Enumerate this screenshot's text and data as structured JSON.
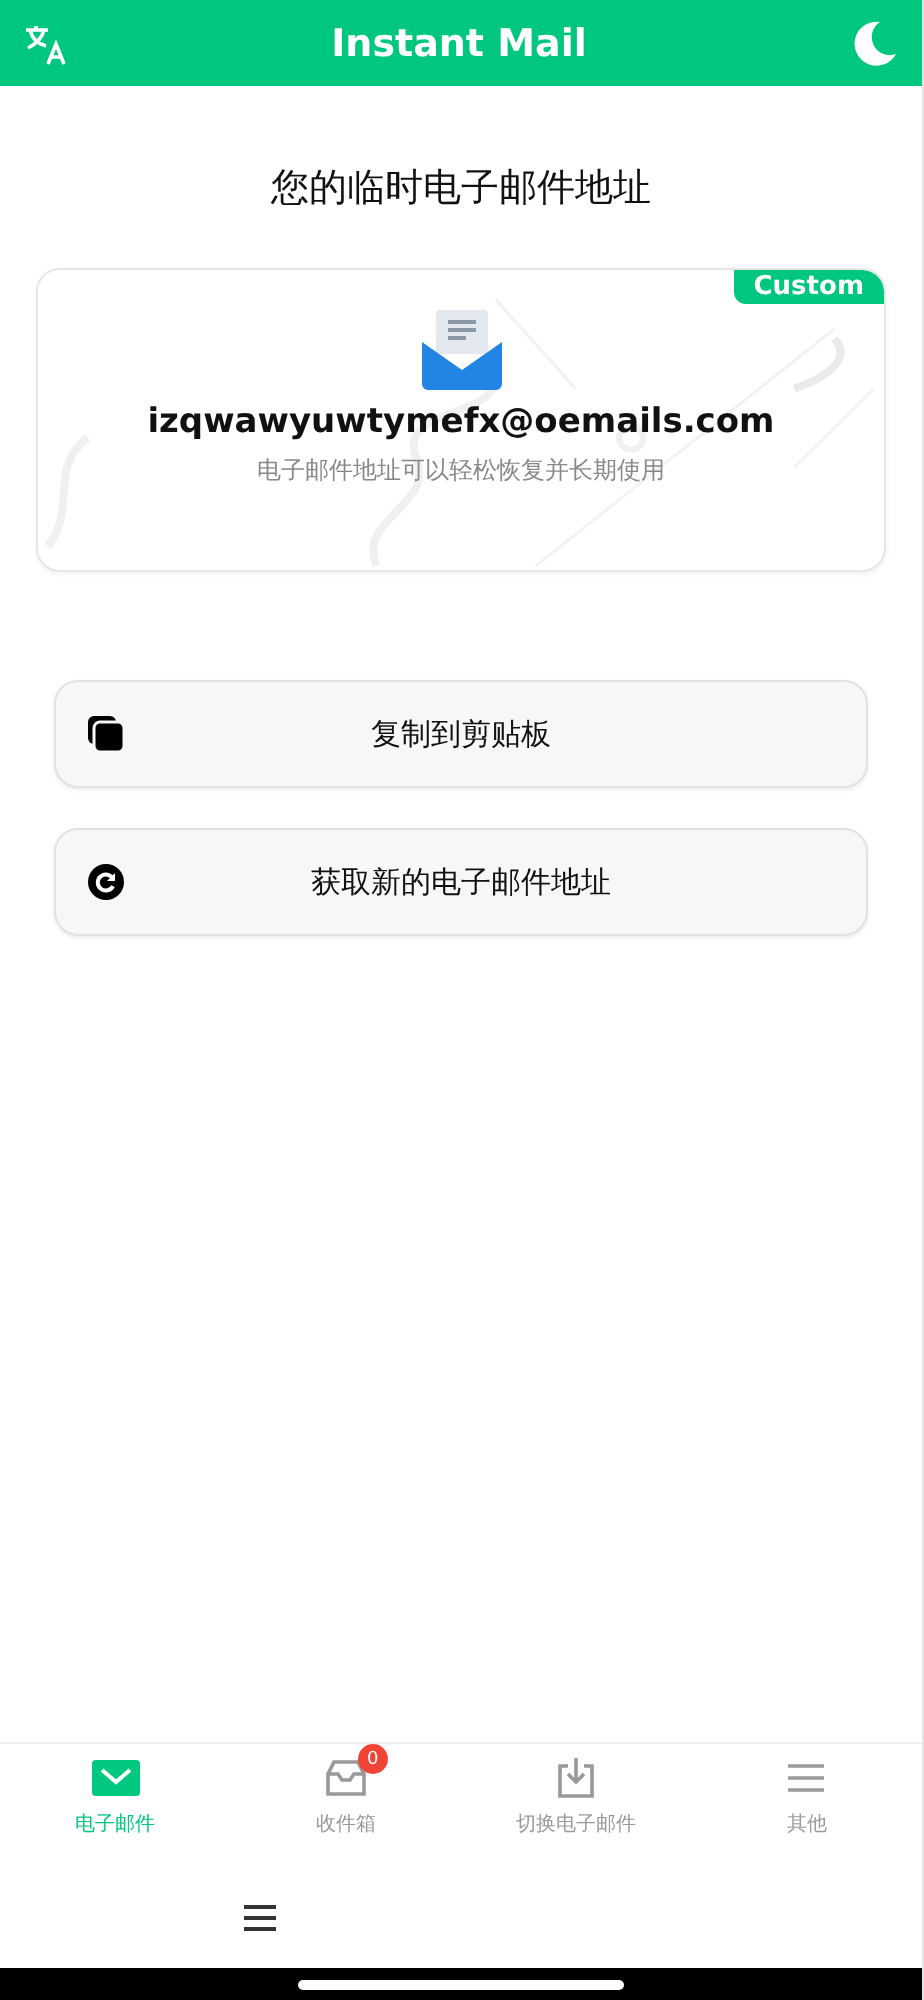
{
  "header": {
    "title": "Instant Mail"
  },
  "heading": "您的临时电子邮件地址",
  "address_card": {
    "badge": "Custom",
    "email": "izqwawyuwtymefx@oemails.com",
    "note": "电子邮件地址可以轻松恢复并长期使用"
  },
  "actions": [
    {
      "kind": "copy",
      "label": "复制到剪贴板"
    },
    {
      "kind": "refresh",
      "label": "获取新的电子邮件地址"
    }
  ],
  "tab_bar": [
    {
      "kind": "mail",
      "label": "电子邮件",
      "selected": true
    },
    {
      "kind": "inbox",
      "label": "收件箱",
      "selected": false,
      "badge": "0"
    },
    {
      "kind": "switch",
      "label": "切换电子邮件",
      "selected": false
    },
    {
      "kind": "more",
      "label": "其他",
      "selected": false
    }
  ]
}
